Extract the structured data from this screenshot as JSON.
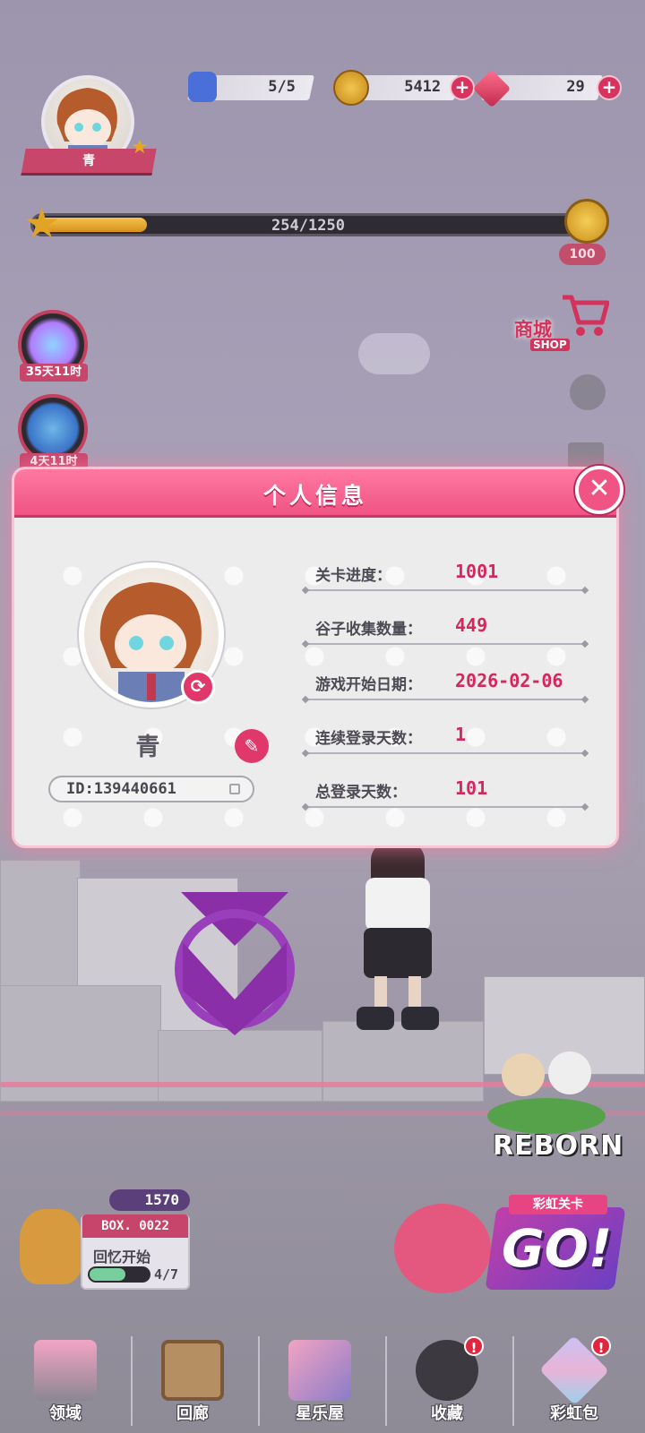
{
  "resources": {
    "energy": "5/5",
    "coins": "5412",
    "gems": "29"
  },
  "player": {
    "name": "青",
    "level_xp": "254/1250",
    "xp_progress": 0.2032,
    "xp_reward": "100"
  },
  "events": [
    {
      "timer": "35天11时"
    },
    {
      "timer": "4天11时"
    }
  ],
  "shop": {
    "label": "商城",
    "sub": "SHOP"
  },
  "modal": {
    "title": "个人信息",
    "close_icon": "close-x",
    "profile": {
      "name": "青",
      "id": "ID:139440661"
    },
    "stats": [
      {
        "label": "关卡进度：",
        "value": "1001"
      },
      {
        "label": "谷子收集数量：",
        "value": "449"
      },
      {
        "label": "游戏开始日期：",
        "value": "2026-02-06"
      },
      {
        "label": "连续登录天数：",
        "value": "1"
      },
      {
        "label": "总登录天数：",
        "value": "101"
      }
    ]
  },
  "box": {
    "gems": "1570",
    "title": "BOX. 0022",
    "subtitle": "回忆开始",
    "progress": "4/7",
    "progress_value": 0.5714
  },
  "rainbow": {
    "label": "彩虹关卡",
    "go": "GO!"
  },
  "reborn": "REBORN",
  "nav": [
    {
      "label": "领域",
      "badge": ""
    },
    {
      "label": "回廊",
      "badge": ""
    },
    {
      "label": "星乐屋",
      "badge": ""
    },
    {
      "label": "收藏",
      "badge": "!"
    },
    {
      "label": "彩虹包",
      "badge": "!"
    }
  ],
  "colors": {
    "accent": "#f05485",
    "stat_value": "#d3275e",
    "nav_badge": "#e0263f"
  }
}
